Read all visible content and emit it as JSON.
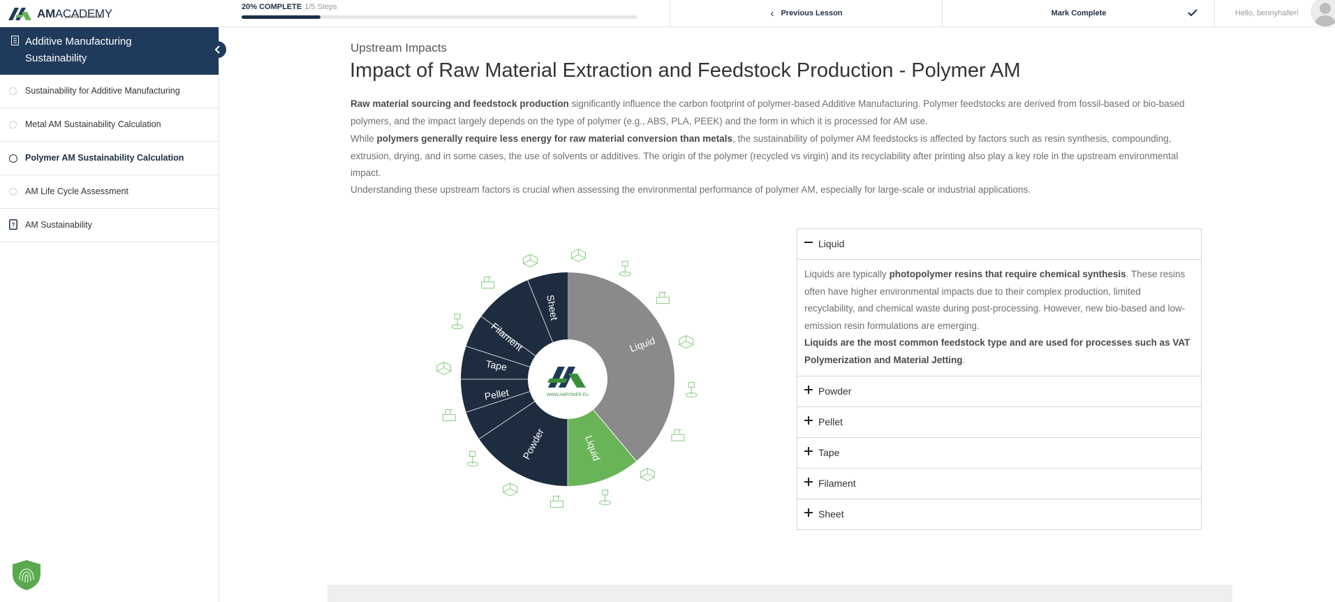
{
  "header": {
    "logo": {
      "brand_bold": "AM",
      "brand_rest": "ACADEMY",
      "tagline": "powered by AMPOWER"
    },
    "progress": {
      "label": "20% COMPLETE",
      "steps": "1/5 Steps",
      "fraction": 0.2
    },
    "previous_label": "Previous Lesson",
    "mark_complete_label": "Mark Complete",
    "greeting": "Hello, bennyhaller!"
  },
  "sidebar": {
    "course_title": "Additive Manufacturing Sustainability",
    "lessons": [
      {
        "label": "Sustainability for Additive Manufacturing"
      },
      {
        "label": "Metal AM Sustainability Calculation"
      },
      {
        "label": "Polymer AM Sustainability Calculation"
      },
      {
        "label": "AM Life Cycle Assessment"
      },
      {
        "label": "AM Sustainability"
      }
    ]
  },
  "main": {
    "kicker": "Upstream Impacts",
    "title": "Impact of Raw Material Extraction and Feedstock Production - Polymer AM",
    "p1_bold": "Raw material sourcing and feedstock production",
    "p1_rest": " significantly influence the carbon footprint of polymer-based Additive Manufacturing. Polymer feedstocks are derived from fossil-based or bio-based polymers, and the impact largely depends on the type of polymer (e.g., ABS, PLA, PEEK) and the form in which it is processed for AM use.",
    "p2_pre": "While ",
    "p2_bold": "polymers generally require less energy for raw material conversion than metals",
    "p2_rest": ", the sustainability of polymer AM feedstocks is affected by factors such as resin synthesis, compounding, extrusion, drying, and in some cases, the use of solvents or additives. The origin of the polymer (recycled vs virgin) and its recyclability after printing also play a key role in the upstream environmental impact.",
    "p3": "Understanding these upstream factors is crucial when assessing the environmental performance of polymer AM, especially for large-scale or industrial applications."
  },
  "wheel": {
    "outer_label": "Liquid",
    "inner_segments": [
      "Liquid",
      "Powder",
      "Pellet",
      "Tape",
      "Filament",
      "Sheet"
    ],
    "center_url": "WWW.AMPOWER.EU",
    "colors": {
      "navy": "#1e2c40",
      "grey": "#8a8a8a",
      "green": "#6ab458",
      "icon": "#8fd08a"
    }
  },
  "accordion": {
    "items": [
      {
        "label": "Liquid",
        "expanded": true
      },
      {
        "label": "Powder",
        "expanded": false
      },
      {
        "label": "Pellet",
        "expanded": false
      },
      {
        "label": "Tape",
        "expanded": false
      },
      {
        "label": "Filament",
        "expanded": false
      },
      {
        "label": "Sheet",
        "expanded": false
      }
    ],
    "liquid_body": {
      "pre": "Liquids are typically ",
      "bold": "photopolymer resins that require chemical synthesis",
      "rest": ". These resins often have higher environmental impacts due to their complex production, limited recyclability, and chemical waste during post-processing. However, new bio-based and low-emission resin formulations are emerging.",
      "bold2": "Liquids are the most common feedstock type and are used for processes such as VAT Polymerization and Material Jetting",
      "end": "."
    }
  }
}
